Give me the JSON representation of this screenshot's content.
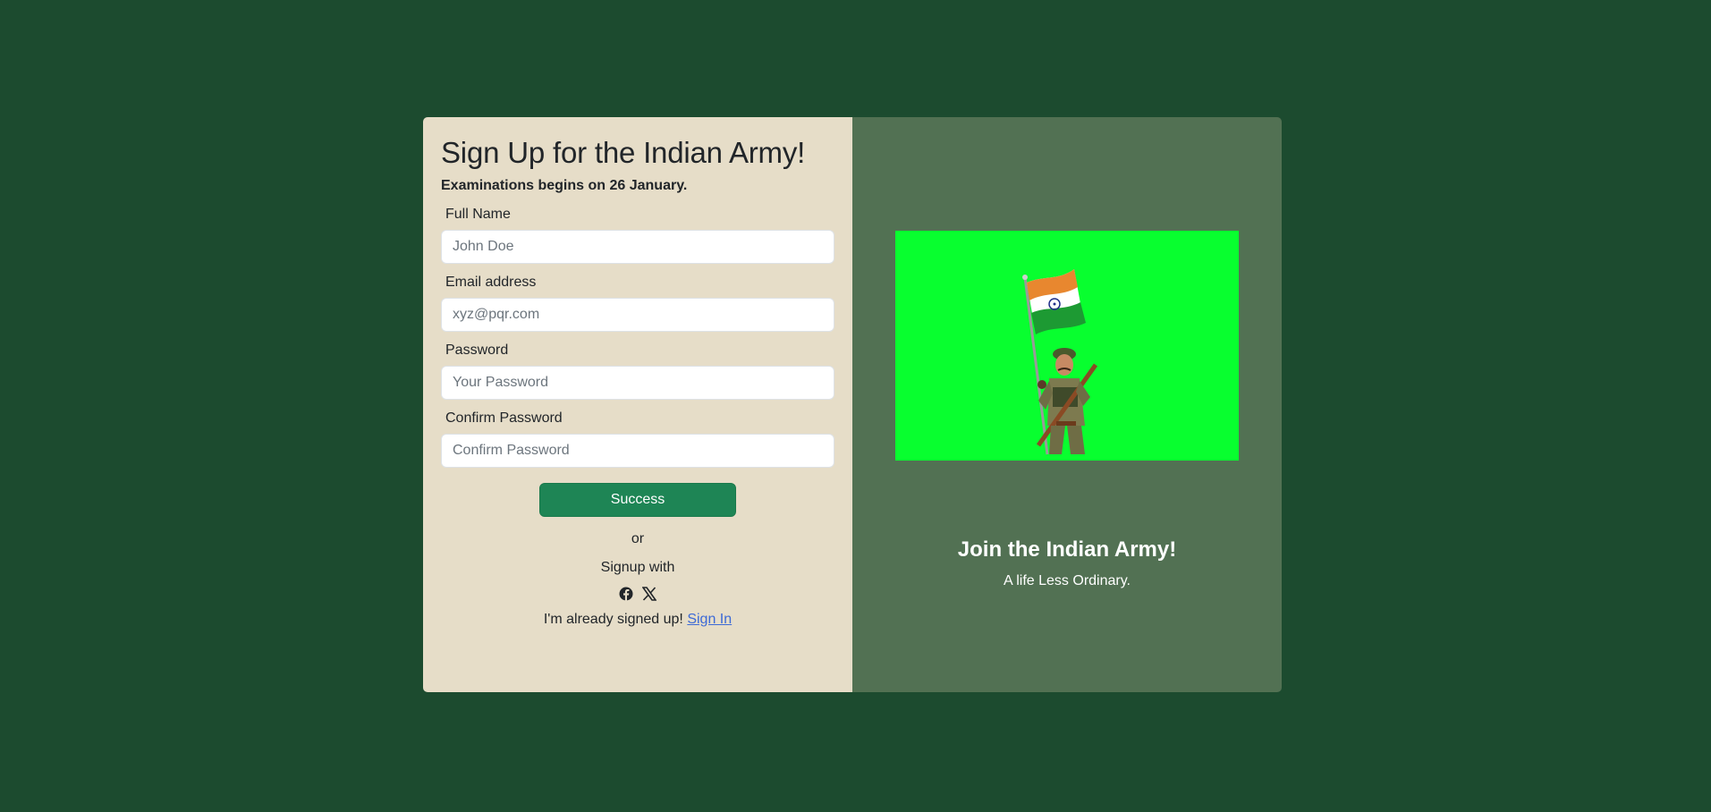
{
  "form": {
    "title": "Sign Up for the Indian Army!",
    "subtitle": "Examinations begins on 26 January.",
    "fields": [
      {
        "label": "Full Name",
        "placeholder": "John Doe"
      },
      {
        "label": "Email address",
        "placeholder": "xyz@pqr.com"
      },
      {
        "label": "Password",
        "placeholder": "Your Password"
      },
      {
        "label": "Confirm Password",
        "placeholder": "Confirm Password"
      }
    ],
    "submit_label": "Success",
    "or_text": "or",
    "signup_with_text": "Signup with",
    "social_icons": [
      "facebook-icon",
      "x-icon"
    ],
    "already_signed_text": "I'm already signed up!",
    "signin_link": "Sign In"
  },
  "promo": {
    "title": "Join the Indian Army!",
    "tagline": "A life Less Ordinary."
  },
  "colors": {
    "page_background": "#1c4b2f",
    "form_panel": "#e6ddc8",
    "promo_panel": "#527153",
    "button": "#1e8555",
    "image_background": "#08ff2f",
    "link": "#3d6ad6"
  }
}
